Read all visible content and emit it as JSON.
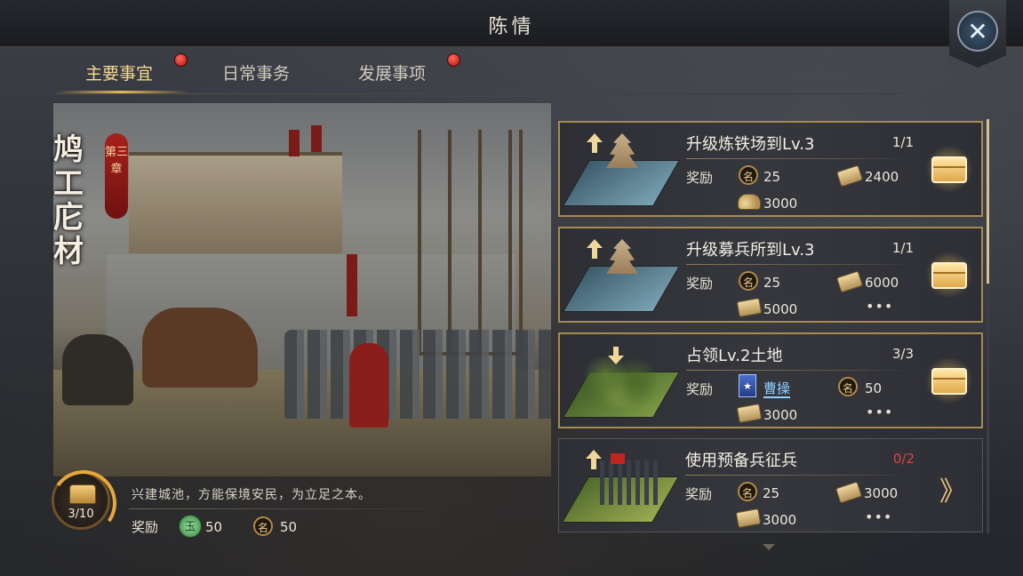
{
  "window": {
    "title": "陈情",
    "close_icon": "crossed-swords-icon"
  },
  "tabs": [
    {
      "label": "主要事宜",
      "active": true,
      "has_alert": true
    },
    {
      "label": "日常事务",
      "active": false,
      "has_alert": false
    },
    {
      "label": "发展事项",
      "active": false,
      "has_alert": true
    }
  ],
  "chapter": {
    "title": "鸠工庀材",
    "tag": "第三章",
    "progress": "3/10",
    "progress_fraction": 0.3,
    "description": "兴建城池，方能保境安民，为立足之本。",
    "reward_label": "奖励",
    "rewards": [
      {
        "icon": "jade-icon",
        "glyph": "玉",
        "value": "50"
      },
      {
        "icon": "ming-icon",
        "glyph": "名",
        "value": "50"
      }
    ]
  },
  "tasks": [
    {
      "title": "升级炼铁场到Lv.3",
      "progress": "1/1",
      "complete": true,
      "reward_label": "奖励",
      "rewards": [
        {
          "icon": "ming-icon",
          "glyph": "名",
          "value": "25"
        },
        {
          "icon": "wood-icon",
          "value": "2400"
        },
        {
          "icon": "grain-icon",
          "value": "3000"
        }
      ],
      "action_icon": "treasure-chest-icon"
    },
    {
      "title": "升级募兵所到Lv.3",
      "progress": "1/1",
      "complete": true,
      "reward_label": "奖励",
      "rewards": [
        {
          "icon": "ming-icon",
          "glyph": "名",
          "value": "25"
        },
        {
          "icon": "wood-icon",
          "value": "6000"
        },
        {
          "icon": "iron-icon",
          "value": "5000"
        }
      ],
      "more": "•••",
      "action_icon": "treasure-chest-icon"
    },
    {
      "title": "占领Lv.2土地",
      "progress": "3/3",
      "complete": true,
      "reward_label": "奖励",
      "rewards": [
        {
          "icon": "hero-card-icon",
          "value": "曹操"
        },
        {
          "icon": "ming-icon",
          "glyph": "名",
          "value": "50"
        },
        {
          "icon": "iron-icon",
          "value": "3000"
        }
      ],
      "more": "•••",
      "action_icon": "treasure-chest-icon"
    },
    {
      "title": "使用预备兵征兵",
      "progress": "0/2",
      "complete": false,
      "reward_label": "奖励",
      "rewards": [
        {
          "icon": "ming-icon",
          "glyph": "名",
          "value": "25"
        },
        {
          "icon": "wood-icon",
          "value": "3000"
        },
        {
          "icon": "iron-icon",
          "value": "3000"
        }
      ],
      "more": "•••",
      "action_icon": "go-arrow-icon",
      "action_glyph": "》"
    }
  ],
  "colors": {
    "accent": "#e3b85c",
    "incomplete": "#e0433a",
    "hero": "#8fd0ff"
  }
}
